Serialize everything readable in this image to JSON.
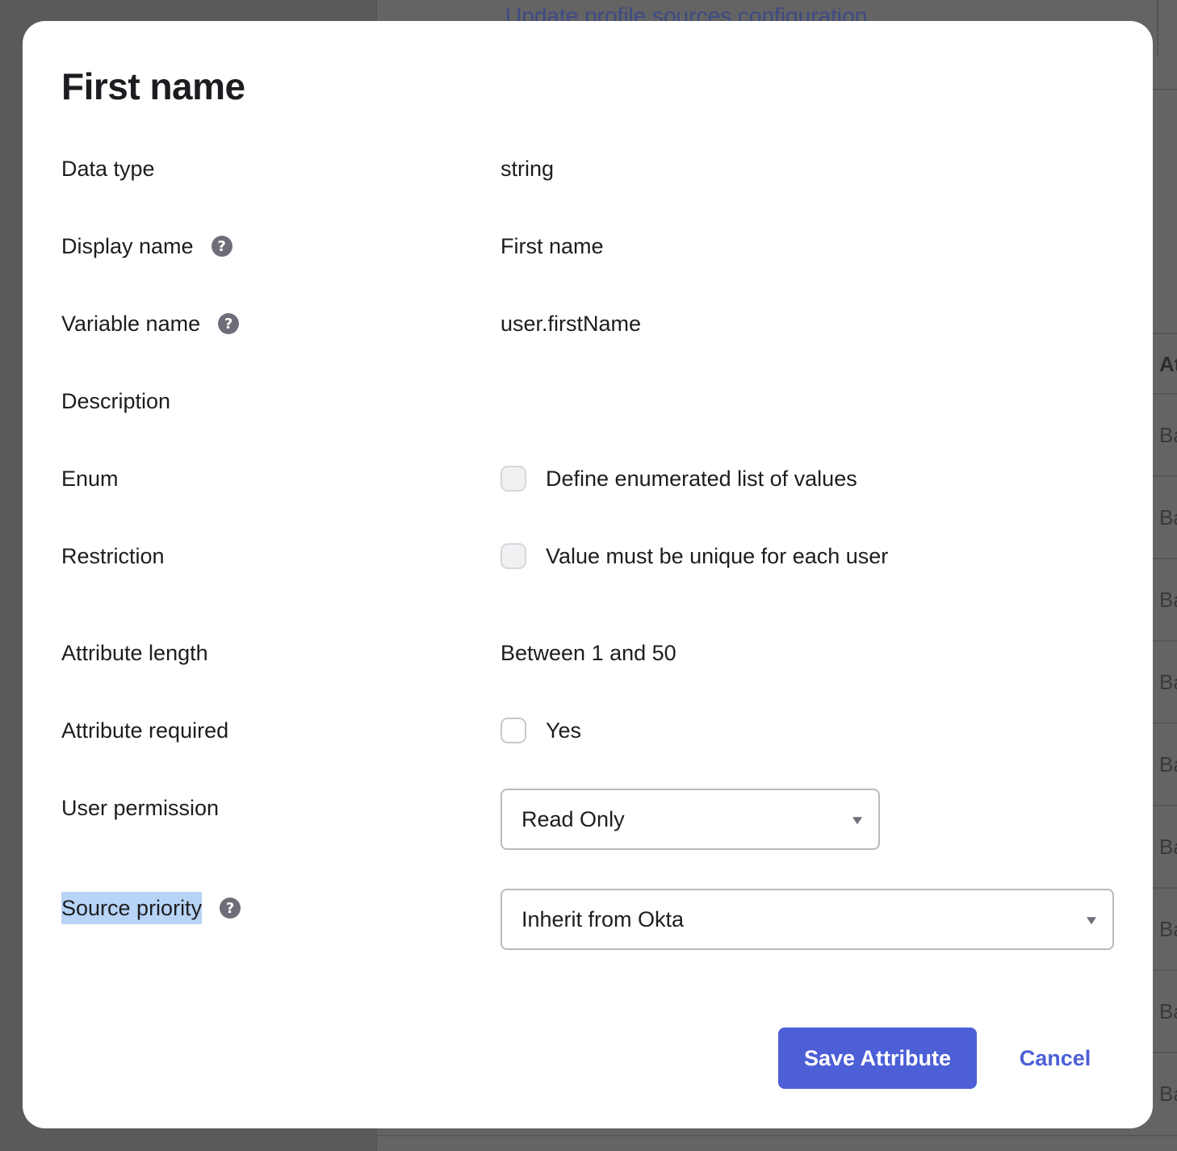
{
  "background": {
    "link_text": "Update profile sources configuration",
    "column_header": "At",
    "row_cells": [
      "Ba",
      "Ba",
      "Ba",
      "Ba",
      "Ba",
      "Ba",
      "Ba",
      "Ba",
      "Ba"
    ]
  },
  "modal": {
    "title": "First name",
    "fields": {
      "data_type": {
        "label": "Data type",
        "value": "string"
      },
      "display_name": {
        "label": "Display name",
        "value": "First name",
        "help": "?"
      },
      "variable_name": {
        "label": "Variable name",
        "value": "user.firstName",
        "help": "?"
      },
      "description": {
        "label": "Description",
        "value": ""
      },
      "enum": {
        "label": "Enum",
        "checkbox_label": "Define enumerated list of values",
        "checked": false
      },
      "restriction": {
        "label": "Restriction",
        "checkbox_label": "Value must be unique for each user",
        "checked": false
      },
      "attribute_length": {
        "label": "Attribute length",
        "value": "Between 1 and 50"
      },
      "attribute_required": {
        "label": "Attribute required",
        "checkbox_label": "Yes",
        "checked": false
      },
      "user_permission": {
        "label": "User permission",
        "selected": "Read Only"
      },
      "source_priority": {
        "label": "Source priority",
        "selected": "Inherit from Okta",
        "help": "?"
      }
    },
    "actions": {
      "save_label": "Save Attribute",
      "cancel_label": "Cancel"
    }
  },
  "colors": {
    "primary": "#4c5fd6",
    "overlay": "#5f5f5f",
    "selection_highlight": "#b7d3f5"
  },
  "icons": {
    "help": "question-circle-icon",
    "select_caret": "caret-down-icon"
  }
}
